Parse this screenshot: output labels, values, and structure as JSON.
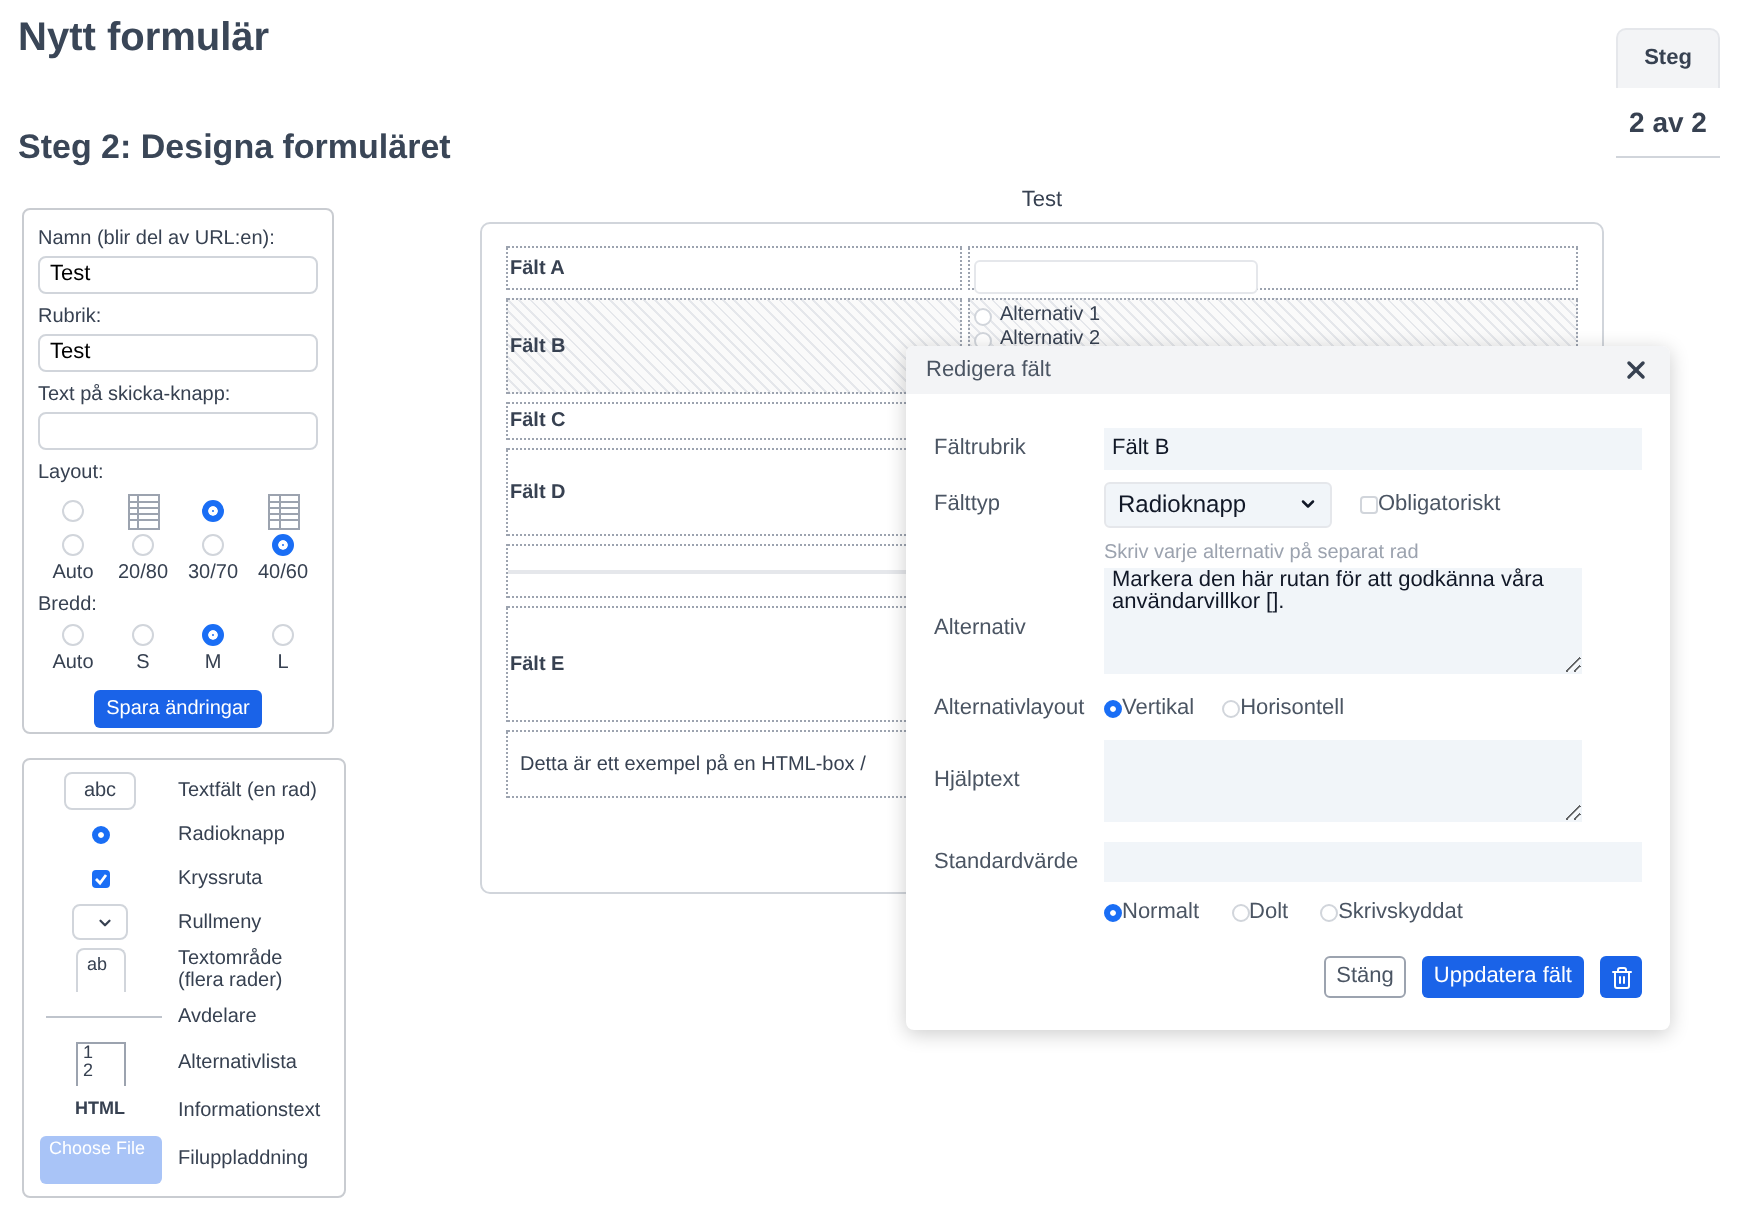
{
  "title": "Nytt formulär",
  "step_tab": {
    "label": "Steg",
    "value": "2 av 2"
  },
  "subtitle": "Steg 2: Designa formuläret",
  "settings": {
    "name": {
      "label": "Namn (blir del av URL:en):",
      "value": "Test"
    },
    "heading": {
      "label": "Rubrik:",
      "value": "Test"
    },
    "submit_text": {
      "label": "Text på skicka-knapp:"
    },
    "layout": {
      "label": "Layout:",
      "presets": [
        {
          "selected": false
        },
        {
          "selected": true
        }
      ],
      "options": [
        {
          "label": "Auto",
          "selected": false
        },
        {
          "label": "20/80",
          "selected": false
        },
        {
          "label": "30/70",
          "selected": false
        },
        {
          "label": "40/60",
          "selected": true
        }
      ]
    },
    "width": {
      "label": "Bredd:",
      "options": [
        {
          "label": "Auto",
          "selected": false
        },
        {
          "label": "S",
          "selected": false
        },
        {
          "label": "M",
          "selected": true
        },
        {
          "label": "L",
          "selected": false
        }
      ]
    },
    "save_button": "Spara ändringar"
  },
  "palette": [
    {
      "kind": "text",
      "label": "Textfält (en rad)",
      "sample": "abc"
    },
    {
      "kind": "radio",
      "label": "Radioknapp",
      "checked": true
    },
    {
      "kind": "checkbox",
      "label": "Kryssruta",
      "checked": true
    },
    {
      "kind": "select",
      "label": "Rullmeny"
    },
    {
      "kind": "textarea",
      "label": "Textområde (flera rader)",
      "sample": "ab"
    },
    {
      "kind": "divider",
      "label": "Avdelare"
    },
    {
      "kind": "listbox",
      "label": "Alternativlista",
      "sample": [
        "1",
        "2"
      ]
    },
    {
      "kind": "html",
      "label": "Informationstext",
      "sample": "HTML"
    },
    {
      "kind": "file",
      "label": "Filuppladdning",
      "sample": "Choose File"
    }
  ],
  "preview": {
    "title": "Test",
    "rows": [
      {
        "kind": "text",
        "label": "Fält A",
        "selected": false
      },
      {
        "kind": "radio",
        "label": "Fält B",
        "selected": true,
        "options": [
          {
            "label": "Alternativ 1",
            "selected": false
          },
          {
            "label": "Alternativ 2",
            "selected": false
          }
        ]
      },
      {
        "kind": "field",
        "label": "Fält C",
        "selected": false
      },
      {
        "kind": "field",
        "label": "Fält D",
        "selected": false
      },
      {
        "kind": "divider",
        "selected": false
      },
      {
        "kind": "field",
        "label": "Fält E",
        "selected": false
      },
      {
        "kind": "html",
        "text": "Detta är ett exempel på en HTML-box /",
        "selected": false
      }
    ]
  },
  "dialog": {
    "title": "Redigera fält",
    "field_label": {
      "label": "Fältrubrik",
      "value": "Fält B"
    },
    "field_type": {
      "label": "Fälttyp",
      "value": "Radioknapp"
    },
    "required": {
      "label": "Obligatoriskt",
      "checked": false
    },
    "options": {
      "label": "Alternativ",
      "hint": "Skriv varje alternativ på separat rad",
      "value": "Markera den här rutan för att godkänna våra användarvillkor []."
    },
    "options_layout": {
      "label": "Alternativlayout",
      "choices": [
        {
          "label": "Vertikal",
          "selected": true
        },
        {
          "label": "Horisontell",
          "selected": false
        }
      ]
    },
    "help_text": {
      "label": "Hjälptext"
    },
    "default_value": {
      "label": "Standardvärde"
    },
    "visibility": {
      "choices": [
        {
          "label": "Normalt",
          "selected": true
        },
        {
          "label": "Dolt",
          "selected": false
        },
        {
          "label": "Skrivskyddat",
          "selected": false
        }
      ]
    },
    "close_button": "Stäng",
    "update_button": "Uppdatera fält"
  }
}
